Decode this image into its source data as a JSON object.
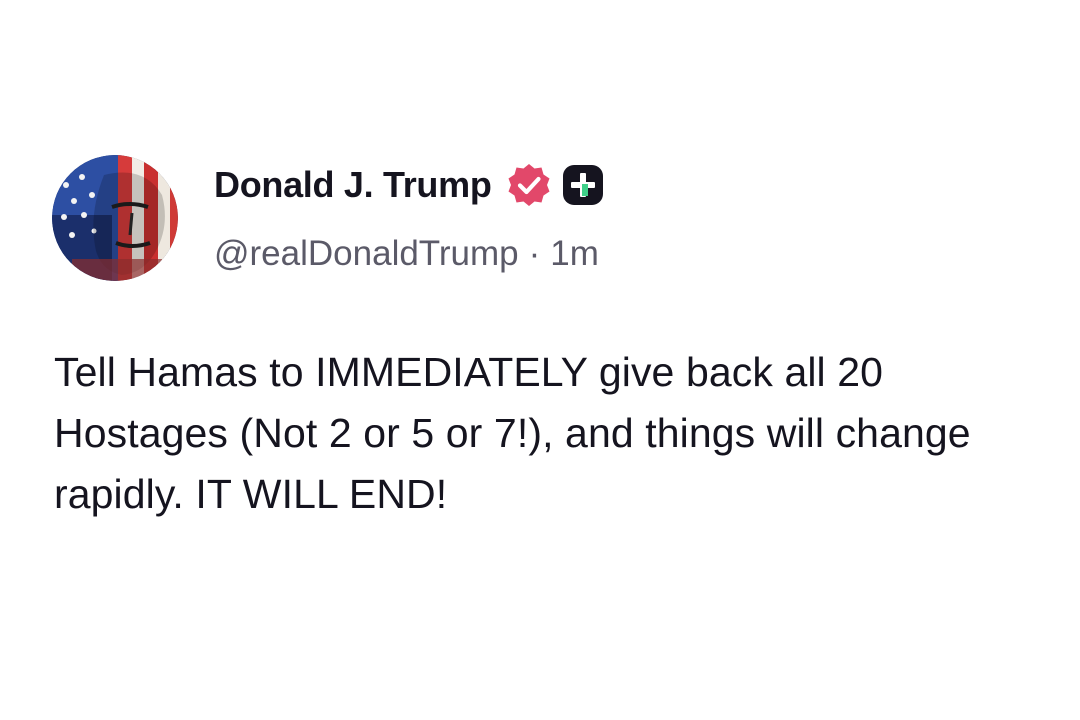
{
  "post": {
    "author": {
      "display_name": "Donald J. Trump",
      "handle": "@realDonaldTrump",
      "verified_icon": "verified-check-icon",
      "badge_icon": "plus-badge-icon",
      "verified_color": "#e2486a"
    },
    "separator": "·",
    "timestamp": "1m",
    "text": "Tell Hamas to IMMEDIATELY give back all 20 Hostages (Not 2 or 5 or 7!), and things will change rapidly. IT WILL END!"
  }
}
